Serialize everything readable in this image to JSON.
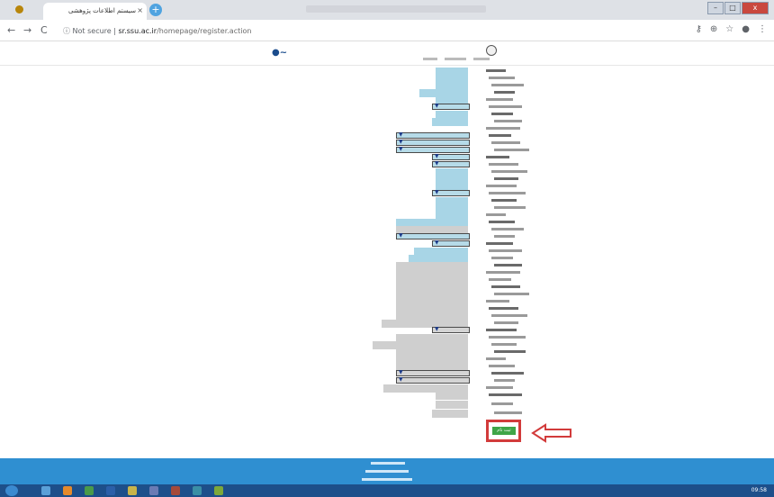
{
  "browser": {
    "tab_title": "سیستم اطلاعات پژوهشی",
    "tab_close": "×",
    "new_tab": "+",
    "back": "←",
    "forward": "→",
    "reload": "C",
    "info_icon": "ⓘ",
    "not_secure": "Not secure",
    "separator": "|",
    "domain": "sr.ssu.ac.ir",
    "path": "/homepage/register.action",
    "icons": [
      "key-icon",
      "zoom-icon",
      "star-icon",
      "profile-icon",
      "menu-icon"
    ]
  },
  "form": {
    "submit_label": "ثبت نام"
  },
  "taskbar": {
    "time": "09:58"
  }
}
